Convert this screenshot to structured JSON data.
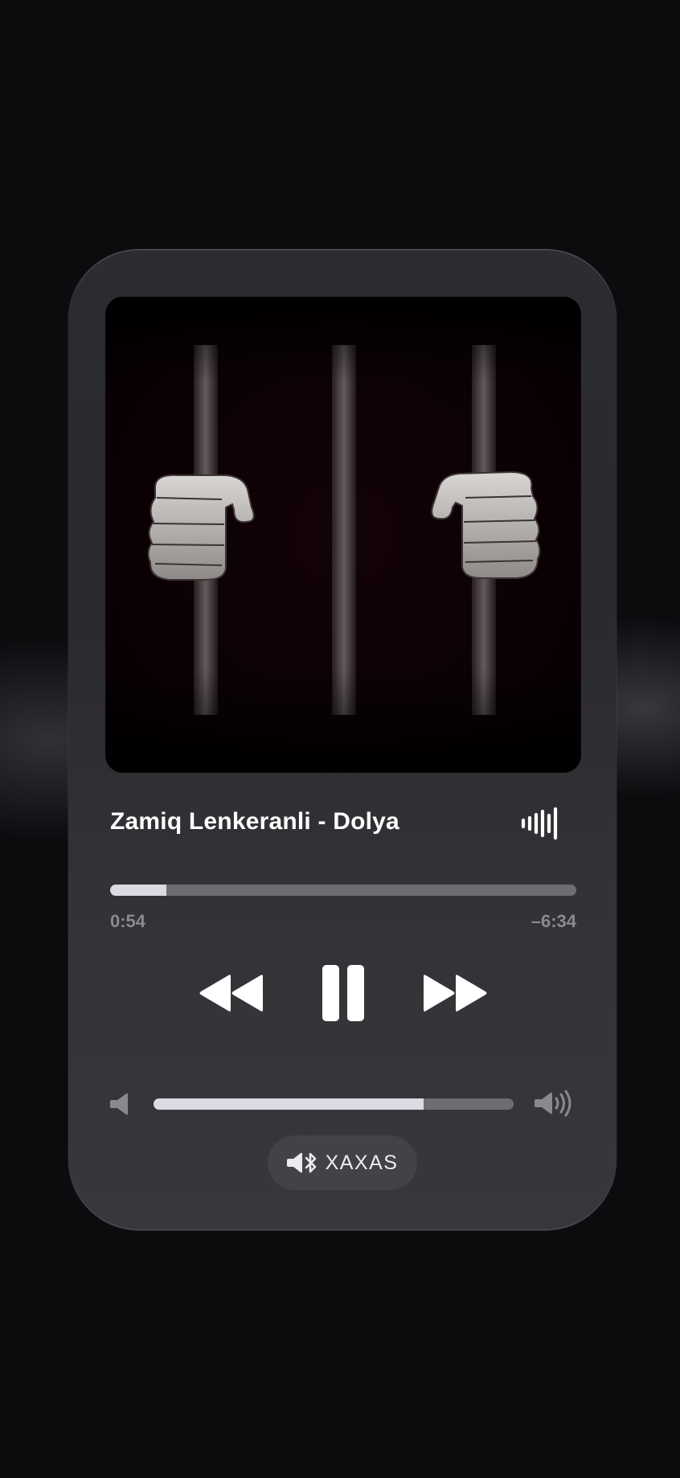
{
  "player": {
    "artwork": {
      "description_icon": "album-artwork"
    },
    "track_title": "Zamiq Lenkeranli - Dolya",
    "progress_fraction": 0.12,
    "time_elapsed": "0:54",
    "time_remaining": "–6:34",
    "controls": {
      "rewind_icon": "rewind-icon",
      "pause_icon": "pause-icon",
      "forward_icon": "fast-forward-icon"
    },
    "volume_fraction": 0.75,
    "output_route": {
      "icon": "speaker-bluetooth-icon",
      "label": "XAXAS"
    },
    "colors": {
      "background": "#0c0b0e",
      "card": "#2f2e32",
      "track_fill": "#dcdbe4",
      "track_empty": "#6e6d72",
      "muted_text": "#8a898e"
    }
  }
}
